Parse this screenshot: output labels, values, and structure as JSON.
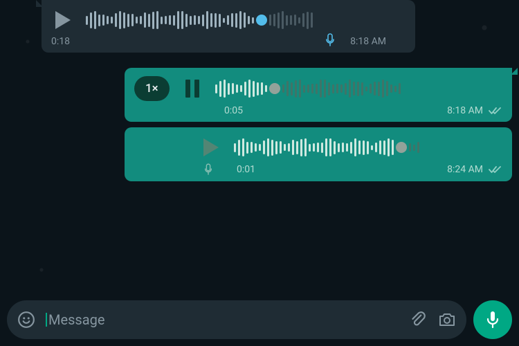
{
  "messages": [
    {
      "direction": "incoming",
      "state": "paused",
      "speed_visible": false,
      "elapsed": "0:18",
      "timestamp": "8:18 AM",
      "read_receipt": false,
      "progress": 0.78,
      "thumb_color": "blue",
      "mic_indicator": true
    },
    {
      "direction": "outgoing",
      "state": "playing",
      "speed_visible": true,
      "speed_label": "1×",
      "elapsed": "0:05",
      "timestamp": "8:18 AM",
      "read_receipt": true,
      "progress": 0.3,
      "thumb_color": "grey",
      "mic_indicator": false
    },
    {
      "direction": "outgoing",
      "state": "paused",
      "speed_visible": false,
      "elapsed": "0:01",
      "timestamp": "8:24 AM",
      "read_receipt": true,
      "progress": 0.92,
      "thumb_color": "grey",
      "mic_indicator": true
    }
  ],
  "input": {
    "placeholder": "Message"
  },
  "colors": {
    "incoming_bubble": "#1f2c34",
    "outgoing_bubble": "#128c7e",
    "accent": "#00a884",
    "wave_played_blue": "#53bdeb",
    "wave_unplayed": "#8696a0"
  }
}
